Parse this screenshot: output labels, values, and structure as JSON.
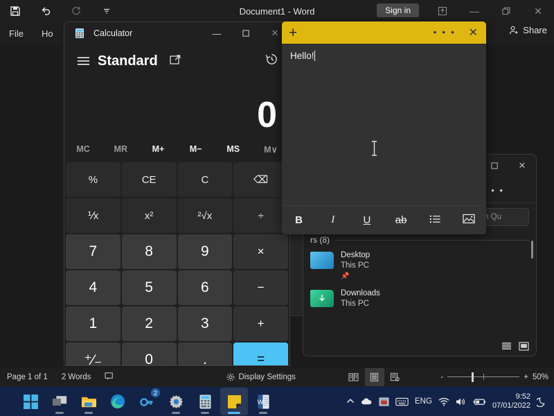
{
  "word": {
    "title": "Document1  -  Word",
    "quick_access": [
      "save-icon",
      "undo-icon",
      "redo-icon",
      "customize-quick-access-icon"
    ],
    "sign_in_label": "Sign in",
    "window_controls": [
      "ribbon-display-options-icon",
      "minimize-icon",
      "restore-icon",
      "close-icon"
    ],
    "tabs": [
      "File",
      "Ho"
    ],
    "share_label": "Share",
    "status": {
      "page": "Page 1 of 1",
      "words": "2 Words",
      "proofing": "proofing-icon",
      "display_settings": "Display Settings",
      "views": [
        "read-mode-icon",
        "print-layout-icon",
        "web-layout-icon"
      ],
      "active_view_index": 1,
      "zoom_out": "-",
      "zoom_in": "+",
      "zoom_level": "50%"
    }
  },
  "explorer": {
    "window_controls": [
      "restore-icon",
      "close-icon"
    ],
    "overflow_menu": "• • •",
    "search_placeholder": "Search Qu",
    "group_header": "rs (8)",
    "items": [
      {
        "name": "Desktop",
        "location": "This PC",
        "pinned": true,
        "color_a": "#49b6e8",
        "color_b": "#1f7fc0"
      },
      {
        "name": "Downloads",
        "location": "This PC",
        "pinned": false,
        "color_a": "#34c38f",
        "color_b": "#0f8f5f"
      }
    ],
    "view_buttons": [
      "details-view-icon",
      "large-icons-view-icon"
    ]
  },
  "calculator": {
    "app_icon": "calculator-icon",
    "title": "Calculator",
    "window_controls": [
      "minimize-icon",
      "maximize-icon",
      "close-icon"
    ],
    "menu_icon": "hamburger-menu-icon",
    "mode": "Standard",
    "keep_on_top_icon": "keep-on-top-icon",
    "history_icon": "history-icon",
    "display_value": "0",
    "memory_buttons": [
      {
        "label": "MC",
        "enabled": false
      },
      {
        "label": "MR",
        "enabled": false
      },
      {
        "label": "M+",
        "enabled": true
      },
      {
        "label": "M−",
        "enabled": true
      },
      {
        "label": "MS",
        "enabled": true
      },
      {
        "label": "M∨",
        "enabled": false
      }
    ],
    "keys": [
      {
        "label": "%",
        "type": "fn"
      },
      {
        "label": "CE",
        "type": "fn"
      },
      {
        "label": "C",
        "type": "fn"
      },
      {
        "label": "⌫",
        "type": "fn"
      },
      {
        "label": "⅟x",
        "type": "fn"
      },
      {
        "label": "x²",
        "type": "fn"
      },
      {
        "label": "²√x",
        "type": "fn"
      },
      {
        "label": "÷",
        "type": "fn"
      },
      {
        "label": "7",
        "type": "num"
      },
      {
        "label": "8",
        "type": "num"
      },
      {
        "label": "9",
        "type": "num"
      },
      {
        "label": "×",
        "type": "op"
      },
      {
        "label": "4",
        "type": "num"
      },
      {
        "label": "5",
        "type": "num"
      },
      {
        "label": "6",
        "type": "num"
      },
      {
        "label": "−",
        "type": "op"
      },
      {
        "label": "1",
        "type": "num"
      },
      {
        "label": "2",
        "type": "num"
      },
      {
        "label": "3",
        "type": "num"
      },
      {
        "label": "+",
        "type": "op"
      },
      {
        "label": "⁺⁄₋",
        "type": "num"
      },
      {
        "label": "0",
        "type": "num"
      },
      {
        "label": ".",
        "type": "num"
      },
      {
        "label": "=",
        "type": "eq"
      }
    ]
  },
  "sticky_note": {
    "header_color": "#e0b711",
    "add_label": "+",
    "menu_label": "• • •",
    "close_label": "✕",
    "note_text": "Hello!",
    "toolbar": [
      {
        "label": "B",
        "name": "bold-icon"
      },
      {
        "label": "I",
        "name": "italic-icon"
      },
      {
        "label": "U",
        "name": "underline-icon"
      },
      {
        "label": "ab",
        "name": "strikethrough-icon"
      },
      {
        "label": "☰",
        "name": "bulleted-list-icon"
      },
      {
        "label": "Ὓc",
        "name": "insert-image-icon"
      }
    ]
  },
  "taskbar": {
    "apps": [
      {
        "name": "start-button",
        "running": false,
        "active": false
      },
      {
        "name": "task-view-button",
        "running": true,
        "active": false
      },
      {
        "name": "file-explorer-button",
        "running": true,
        "active": false
      },
      {
        "name": "edge-button",
        "running": false,
        "active": false
      },
      {
        "name": "key-app-button",
        "running": false,
        "active": false,
        "badge": "2"
      },
      {
        "name": "settings-button",
        "running": true,
        "active": false
      },
      {
        "name": "calculator-button",
        "running": true,
        "active": false
      },
      {
        "name": "sticky-notes-button",
        "running": true,
        "active": true
      },
      {
        "name": "word-button",
        "running": true,
        "active": false
      }
    ],
    "tray": {
      "show_hidden_icons": "chevron-up-icon",
      "onedrive": "cloud-icon",
      "app_tray_icon": "tray-app-icon",
      "keyboard": "keyboard-icon",
      "language": "ENG",
      "network": "wifi-icon",
      "volume": "speaker-icon",
      "battery": "battery-charging-icon",
      "time": "9:52",
      "date": "07/01/2022",
      "focus_assist": "moon-icon"
    }
  }
}
